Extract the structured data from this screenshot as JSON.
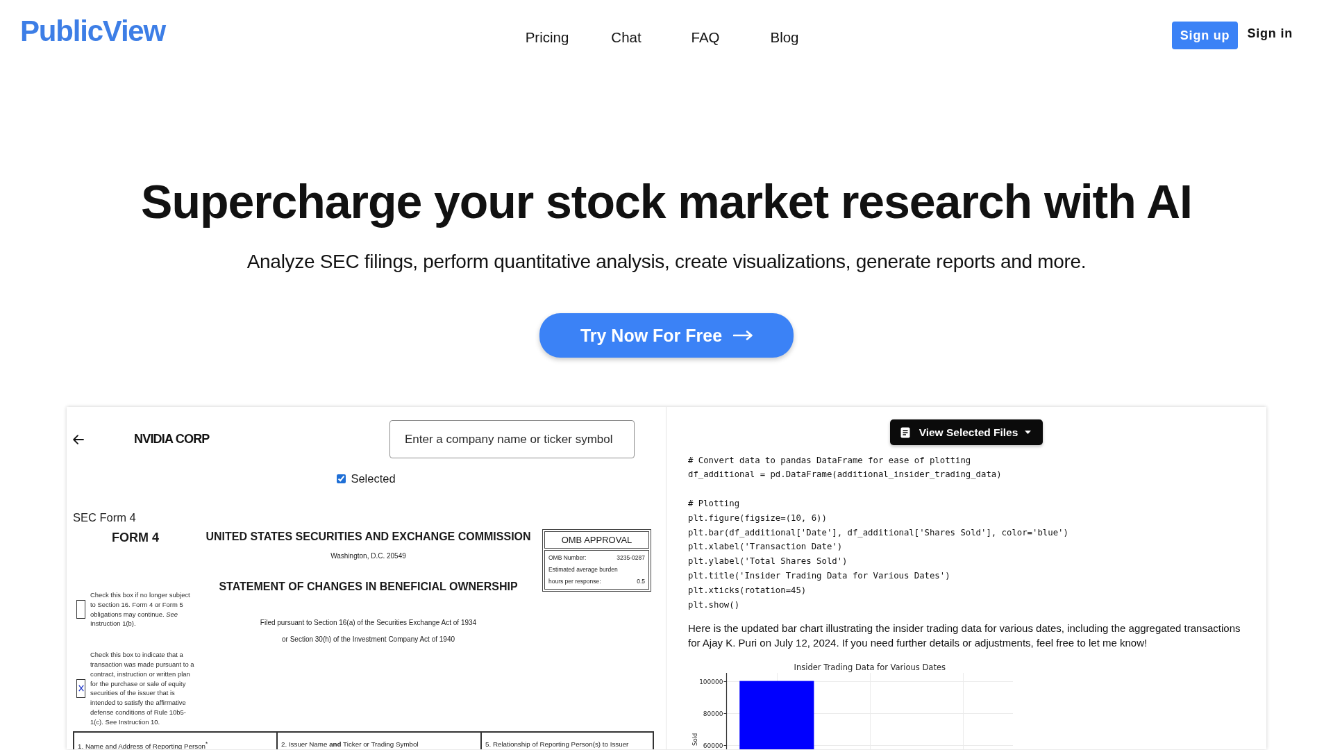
{
  "header": {
    "logo": "PublicView",
    "nav": [
      "Pricing",
      "Chat",
      "FAQ",
      "Blog"
    ],
    "actions": [
      {
        "label": "Sign up",
        "kind": "primary"
      },
      {
        "label": "Sign in",
        "kind": "text"
      }
    ]
  },
  "hero": {
    "title": "Supercharge your stock market research with AI",
    "subtitle": "Analyze SEC filings, perform quantitative analysis, create visualizations, generate reports and more.",
    "cta": "Try Now For Free"
  },
  "demo": {
    "filing": {
      "company": "NVIDIA CORP",
      "search": {
        "placeholder": "Enter a company name or ticker symbol"
      },
      "selected": {
        "label": "Selected",
        "checked": true
      },
      "document_label": "SEC Form 4",
      "form": {
        "number": "FORM 4",
        "agency": "UNITED STATES SECURITIES AND EXCHANGE COMMISSION",
        "address": "Washington, D.C. 20549",
        "title": "STATEMENT OF CHANGES IN BENEFICIAL OWNERSHIP",
        "notes": [
          "Filed pursuant to Section 16(a) of the Securities Exchange Act of 1934",
          "or Section 30(h) of the Investment Company Act of 1940"
        ],
        "omb": {
          "heading": "OMB APPROVAL",
          "rows": [
            {
              "label": "OMB Number:",
              "value": "3235-0287"
            },
            {
              "label": "Estimated average burden"
            },
            {
              "label": "hours per response:",
              "value": "0.5"
            }
          ]
        },
        "checkboxes": [
          {
            "text": "Check this box if no longer subject to Section 16. Form 4 or Form 5 obligations may continue. *See* Instruction 1(b).",
            "checked": false
          },
          {
            "text": "Check this box to indicate that a transaction was made pursuant to a contract, instruction or written plan for the purchase or sale of equity securities of the issuer that is intended to satisfy the affirmative defense conditions of Rule 10b5-1(c). See Instruction 10.",
            "checked": true
          }
        ],
        "table_headers": [
          "1. Name and Address of Reporting Person$^{*}$",
          "2. Issuer Name **and** Ticker or Trading Symbol",
          "5. Relationship of Reporting Person(s) to Issuer"
        ]
      }
    },
    "chat": {
      "files_button": "View Selected Files",
      "code": [
        [
          "# Convert data to pandas DataFrame for ease of plotting",
          "df_additional = pd.DataFrame(additional_insider_trading_data)"
        ],
        [
          "# Plotting",
          "plt.figure(figsize=(10, 6))",
          "plt.bar(df_additional['Date'], df_additional['Shares Sold'], color='blue')",
          "plt.xlabel('Transaction Date')",
          "plt.ylabel('Total Shares Sold')",
          "plt.title('Insider Trading Data for Various Dates')",
          "plt.xticks(rotation=45)",
          "plt.show()"
        ]
      ],
      "message": "Here is the updated bar chart illustrating the insider trading data for various dates, including the aggregated transactions for Ajay K. Puri on July 12, 2024. If you need further details or adjustments, feel free to let me know!",
      "chart_data": {
        "type": "bar",
        "title": "Insider Trading Data for Various Dates",
        "ylabel": "Sold",
        "series": [
          {
            "color": "#0000ff",
            "values": [
              100000,
              null,
              null
            ]
          }
        ],
        "ylim": [
          57600,
          105000
        ],
        "yticks": [
          60000,
          80000,
          100000
        ],
        "grid": true
      }
    }
  }
}
